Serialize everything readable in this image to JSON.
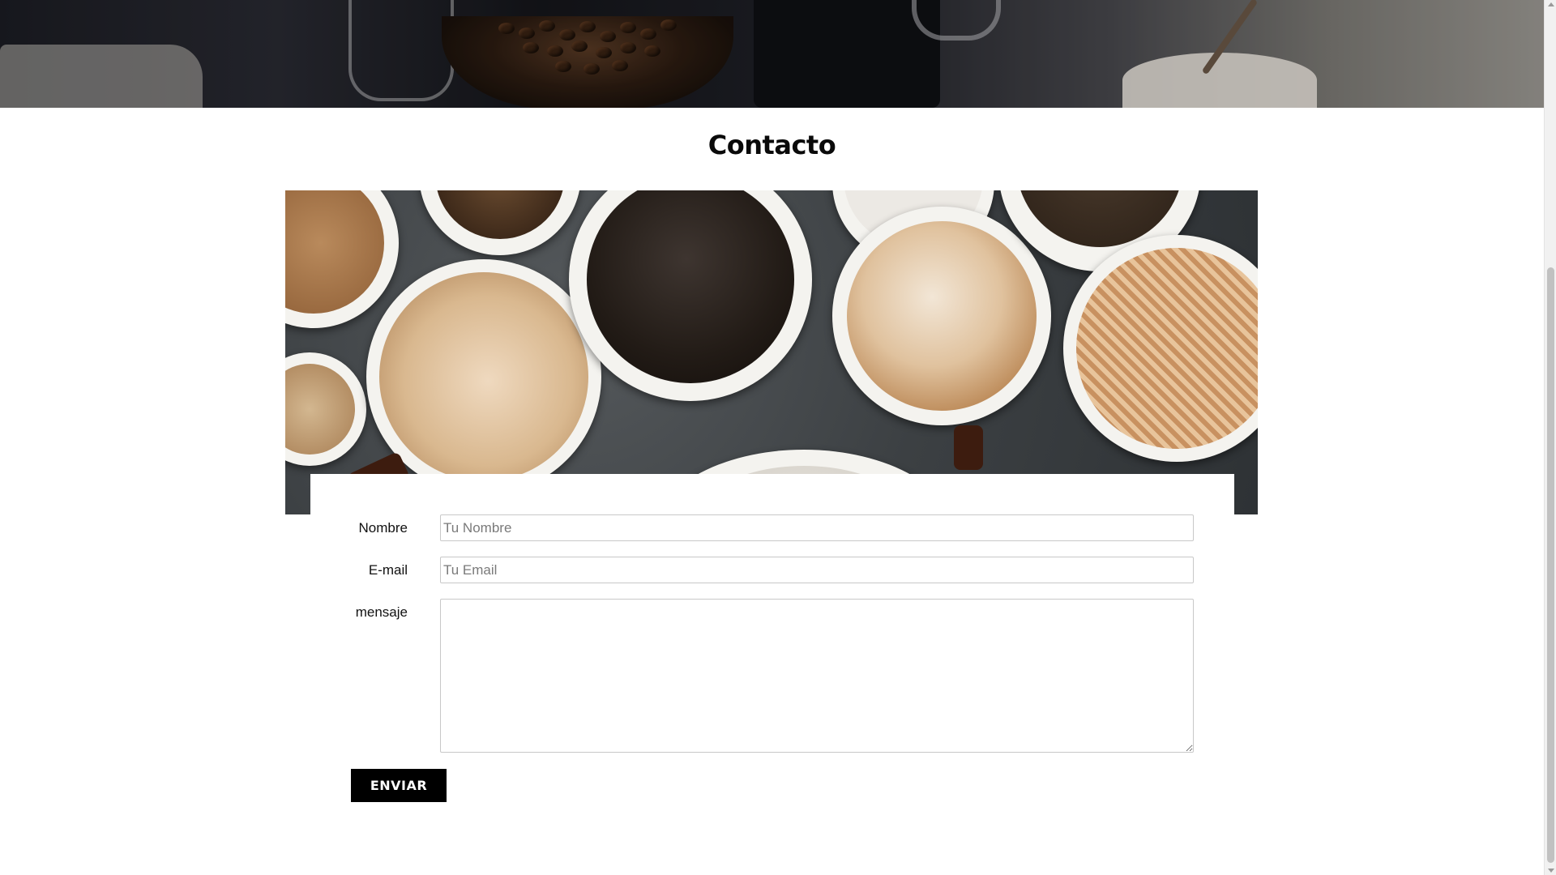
{
  "section": {
    "title": "Contacto"
  },
  "hero": {
    "image_subject": "coffee-table-banner"
  },
  "cups_image": {
    "image_subject": "coffee-cups-top-view"
  },
  "form": {
    "name": {
      "label": "Nombre",
      "placeholder": "Tu Nombre",
      "value": ""
    },
    "email": {
      "label": "E-mail",
      "placeholder": "Tu Email",
      "value": ""
    },
    "message": {
      "label": "mensaje",
      "value": ""
    },
    "submit_label": "ENVIAR"
  },
  "colors": {
    "button_bg": "#000000",
    "button_text": "#ffffff",
    "input_border": "#c8c8c8",
    "page_bg": "#ffffff"
  },
  "icons": {
    "scroll_up": "chevron-up-icon",
    "scroll_down": "chevron-down-icon",
    "textarea_resize": "resize-grip-icon"
  }
}
